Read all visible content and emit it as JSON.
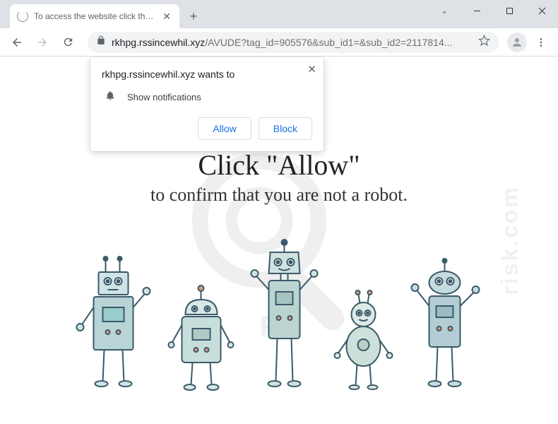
{
  "window": {
    "tab_title": "To access the website click the \"A"
  },
  "toolbar": {
    "url_domain": "rkhpg.rssincewhil.xyz",
    "url_path": "/AVUDE?tag_id=905576&sub_id1=&sub_id2=2117814..."
  },
  "permission": {
    "origin_text": "rkhpg.rssincewhil.xyz wants to",
    "request_text": "Show notifications",
    "allow_label": "Allow",
    "block_label": "Block"
  },
  "page": {
    "headline": "Click \"Allow\"",
    "subline": "to confirm that you are not a robot."
  },
  "watermark": {
    "side_text": "risk.com"
  }
}
